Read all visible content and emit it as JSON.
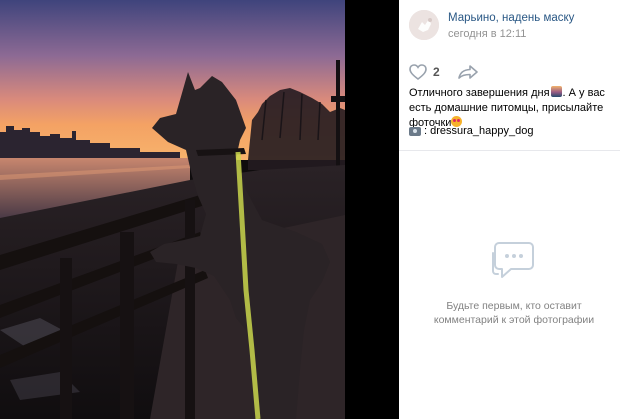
{
  "post": {
    "author": "Марьино, надень маску",
    "date": "сегодня в 12:11",
    "likes": "2",
    "text_part1": "Отличного завершения дня",
    "text_part2": ". А у вас есть домашние питомцы, присылайте фоточки",
    "tag": ": dressura_happy_dog"
  },
  "comments": {
    "empty_text": "Будьте первым, кто оставит комментарий к этой фотографии"
  },
  "icons": {
    "like": "heart-outline-icon",
    "share": "share-arrow-icon",
    "empty": "comments-bubble-icon",
    "tag": "camera-icon"
  },
  "colors": {
    "link": "#2a5885",
    "muted": "#939393",
    "icon": "#99a2ad",
    "empty_icon": "#c5d0db",
    "photo_sky_top": "#4a4e86",
    "photo_sky_horizon": "#f3a668"
  }
}
